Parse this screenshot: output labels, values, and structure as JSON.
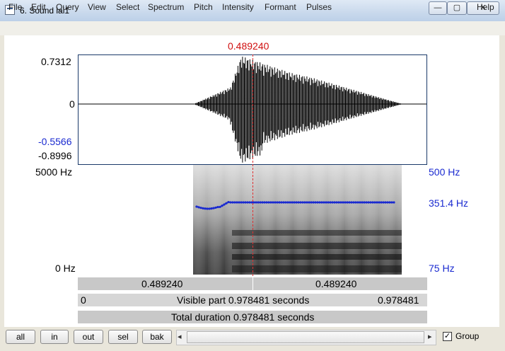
{
  "window": {
    "title": "6. Sound lai1",
    "minimize_glyph": "—",
    "maximize_glyph": "▢",
    "close_glyph": "✕"
  },
  "menu": [
    "File",
    "Edit",
    "Query",
    "View",
    "Select",
    "Spectrum",
    "Pitch",
    "Intensity",
    "Formant",
    "Pulses"
  ],
  "help": "Help",
  "waveform": {
    "cursor_time": "0.489240",
    "y_max": "0.7312",
    "y_zero": "0",
    "y_neg1": "-0.5566",
    "y_neg2": "-0.8996"
  },
  "spectrogram": {
    "freq_max": "5000 Hz",
    "freq_min": "0 Hz",
    "pitch_max": "500 Hz",
    "pitch_current": "351.4 Hz",
    "pitch_min": "75 Hz"
  },
  "bars": {
    "left_time": "0.489240",
    "right_time": "0.489240",
    "visible_start": "0",
    "visible_text": "Visible part 0.978481 seconds",
    "visible_end": "0.978481",
    "total_text": "Total duration 0.978481 seconds"
  },
  "toolbar": {
    "all": "all",
    "in": "in",
    "out": "out",
    "sel": "sel",
    "bak": "bak",
    "group": "Group",
    "group_checked": "✓",
    "scroll_left": "◂",
    "scroll_right": "▸"
  },
  "colors": {
    "cursor": "#d01010",
    "pitch": "#1a2ad0",
    "axis_blue": "#1a2ad0"
  }
}
